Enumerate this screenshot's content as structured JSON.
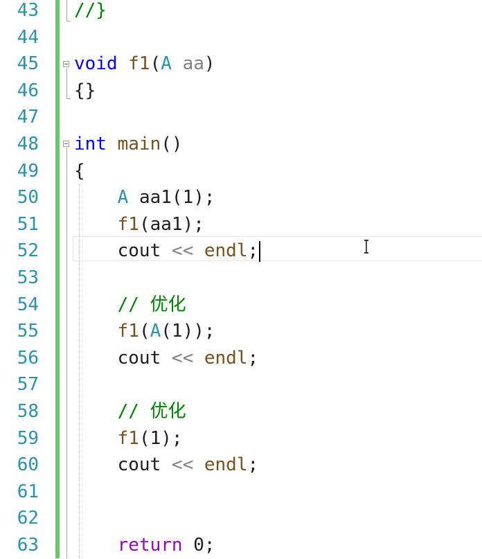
{
  "editor": {
    "lines": [
      {
        "num": "43",
        "code": "//}"
      },
      {
        "num": "44",
        "code": ""
      },
      {
        "num": "45",
        "code": "void f1(A aa)"
      },
      {
        "num": "46",
        "code": "{}"
      },
      {
        "num": "47",
        "code": ""
      },
      {
        "num": "48",
        "code": "int main()"
      },
      {
        "num": "49",
        "code": "{"
      },
      {
        "num": "50",
        "code": "    A aa1(1);"
      },
      {
        "num": "51",
        "code": "    f1(aa1);"
      },
      {
        "num": "52",
        "code": "    cout << endl;"
      },
      {
        "num": "53",
        "code": ""
      },
      {
        "num": "54",
        "code": "    // 优化"
      },
      {
        "num": "55",
        "code": "    f1(A(1));"
      },
      {
        "num": "56",
        "code": "    cout << endl;"
      },
      {
        "num": "57",
        "code": ""
      },
      {
        "num": "58",
        "code": "    // 优化"
      },
      {
        "num": "59",
        "code": "    f1(1);"
      },
      {
        "num": "60",
        "code": "    cout << endl;"
      },
      {
        "num": "61",
        "code": ""
      },
      {
        "num": "62",
        "code": ""
      },
      {
        "num": "63",
        "code": "    return 0;"
      }
    ],
    "current_line": "52",
    "colors": {
      "line_number": "#2b91af",
      "keyword": "#0000ff",
      "control_keyword": "#8f08c4",
      "type": "#2b91af",
      "function": "#74531f",
      "parameter": "#808080",
      "comment": "#008000",
      "change_bar": "#6cc76c"
    }
  }
}
